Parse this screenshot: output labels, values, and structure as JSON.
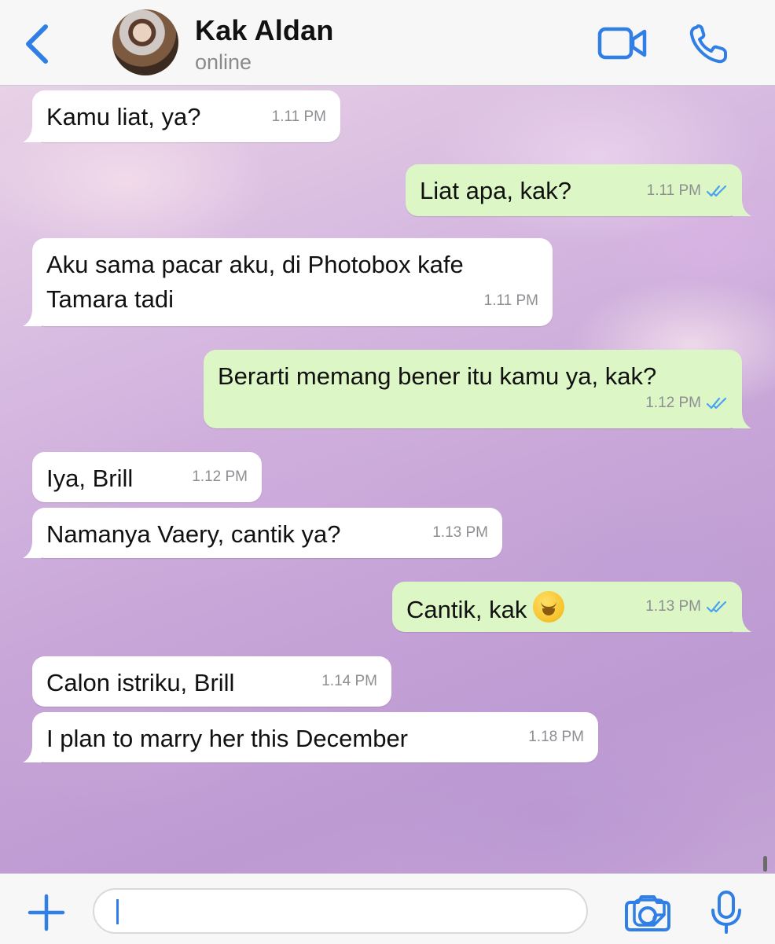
{
  "header": {
    "contact_name": "Kak Aldan",
    "status": "online"
  },
  "colors": {
    "accent": "#2f7fe6",
    "incoming_bubble": "#ffffff",
    "outgoing_bubble": "#dcf7c5",
    "read_ticks": "#4aa3f0"
  },
  "messages": [
    {
      "dir": "in",
      "text": "Kamu liat, ya?",
      "time": "1.11 PM"
    },
    {
      "dir": "out",
      "text": "Liat apa, kak?",
      "time": "1.11 PM",
      "status": "read"
    },
    {
      "dir": "in",
      "text": "Aku sama pacar aku, di Photobox kafe\nTamara tadi",
      "time": "1.11 PM"
    },
    {
      "dir": "out",
      "text": "Berarti memang bener itu kamu ya, kak?",
      "time": "1.12 PM",
      "status": "read"
    },
    {
      "dir": "in",
      "text": "Iya, Brill",
      "time": "1.12 PM"
    },
    {
      "dir": "in",
      "text": "Namanya Vaery, cantik ya?",
      "time": "1.13 PM"
    },
    {
      "dir": "out",
      "text": "Cantik, kak",
      "emoji": "hugging-face",
      "time": "1.13 PM",
      "status": "read"
    },
    {
      "dir": "in",
      "text": "Calon istriku, Brill",
      "time": "1.14 PM"
    },
    {
      "dir": "in",
      "text": "I plan to marry her this December",
      "time": "1.18 PM"
    }
  ],
  "composer": {
    "value": "",
    "icons": [
      "plus-icon",
      "sticker-icon",
      "camera-icon",
      "microphone-icon"
    ]
  }
}
